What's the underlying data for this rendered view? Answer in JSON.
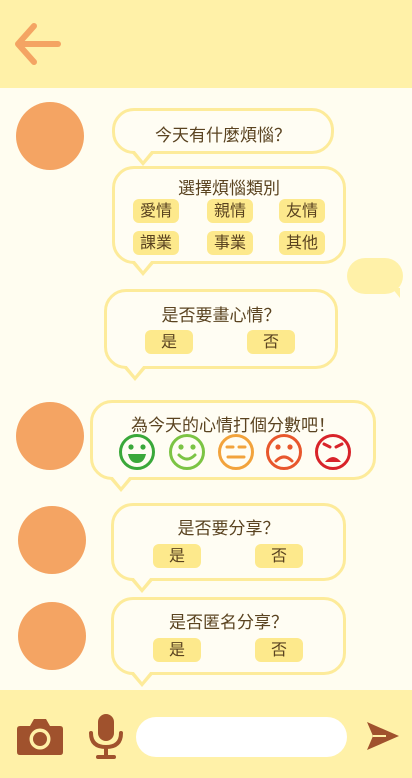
{
  "header": {
    "back_icon": "arrow-left-icon",
    "accent": "#f4a463"
  },
  "messages": {
    "q1": {
      "text": "今天有什麼煩惱？"
    },
    "q2": {
      "title": "選擇煩惱類別",
      "options": [
        "愛情",
        "親情",
        "友情",
        "課業",
        "事業",
        "其他"
      ]
    },
    "q3": {
      "title": "是否要畫心情？",
      "yes": "是",
      "no": "否"
    },
    "q4": {
      "title": "為今天的心情打個分數吧！",
      "faces": [
        {
          "name": "very-happy-face-icon",
          "color": "#3aa83a"
        },
        {
          "name": "happy-face-icon",
          "color": "#7cc444"
        },
        {
          "name": "neutral-face-icon",
          "color": "#f2a33c"
        },
        {
          "name": "sad-face-icon",
          "color": "#e8572c"
        },
        {
          "name": "very-sad-face-icon",
          "color": "#d8232a"
        }
      ]
    },
    "q5": {
      "title": "是否要分享？",
      "yes": "是",
      "no": "否"
    },
    "q6": {
      "title": "是否匿名分享？",
      "yes": "是",
      "no": "否"
    }
  },
  "composer": {
    "camera_icon": "camera-icon",
    "mic_icon": "microphone-icon",
    "send_icon": "send-icon",
    "input_value": "",
    "input_placeholder": ""
  },
  "colors": {
    "bar": "#fff1a8",
    "bubble_border": "#fdeb9a",
    "chip": "#fde98c",
    "avatar": "#f4a463",
    "icon_brown": "#a0522d"
  }
}
